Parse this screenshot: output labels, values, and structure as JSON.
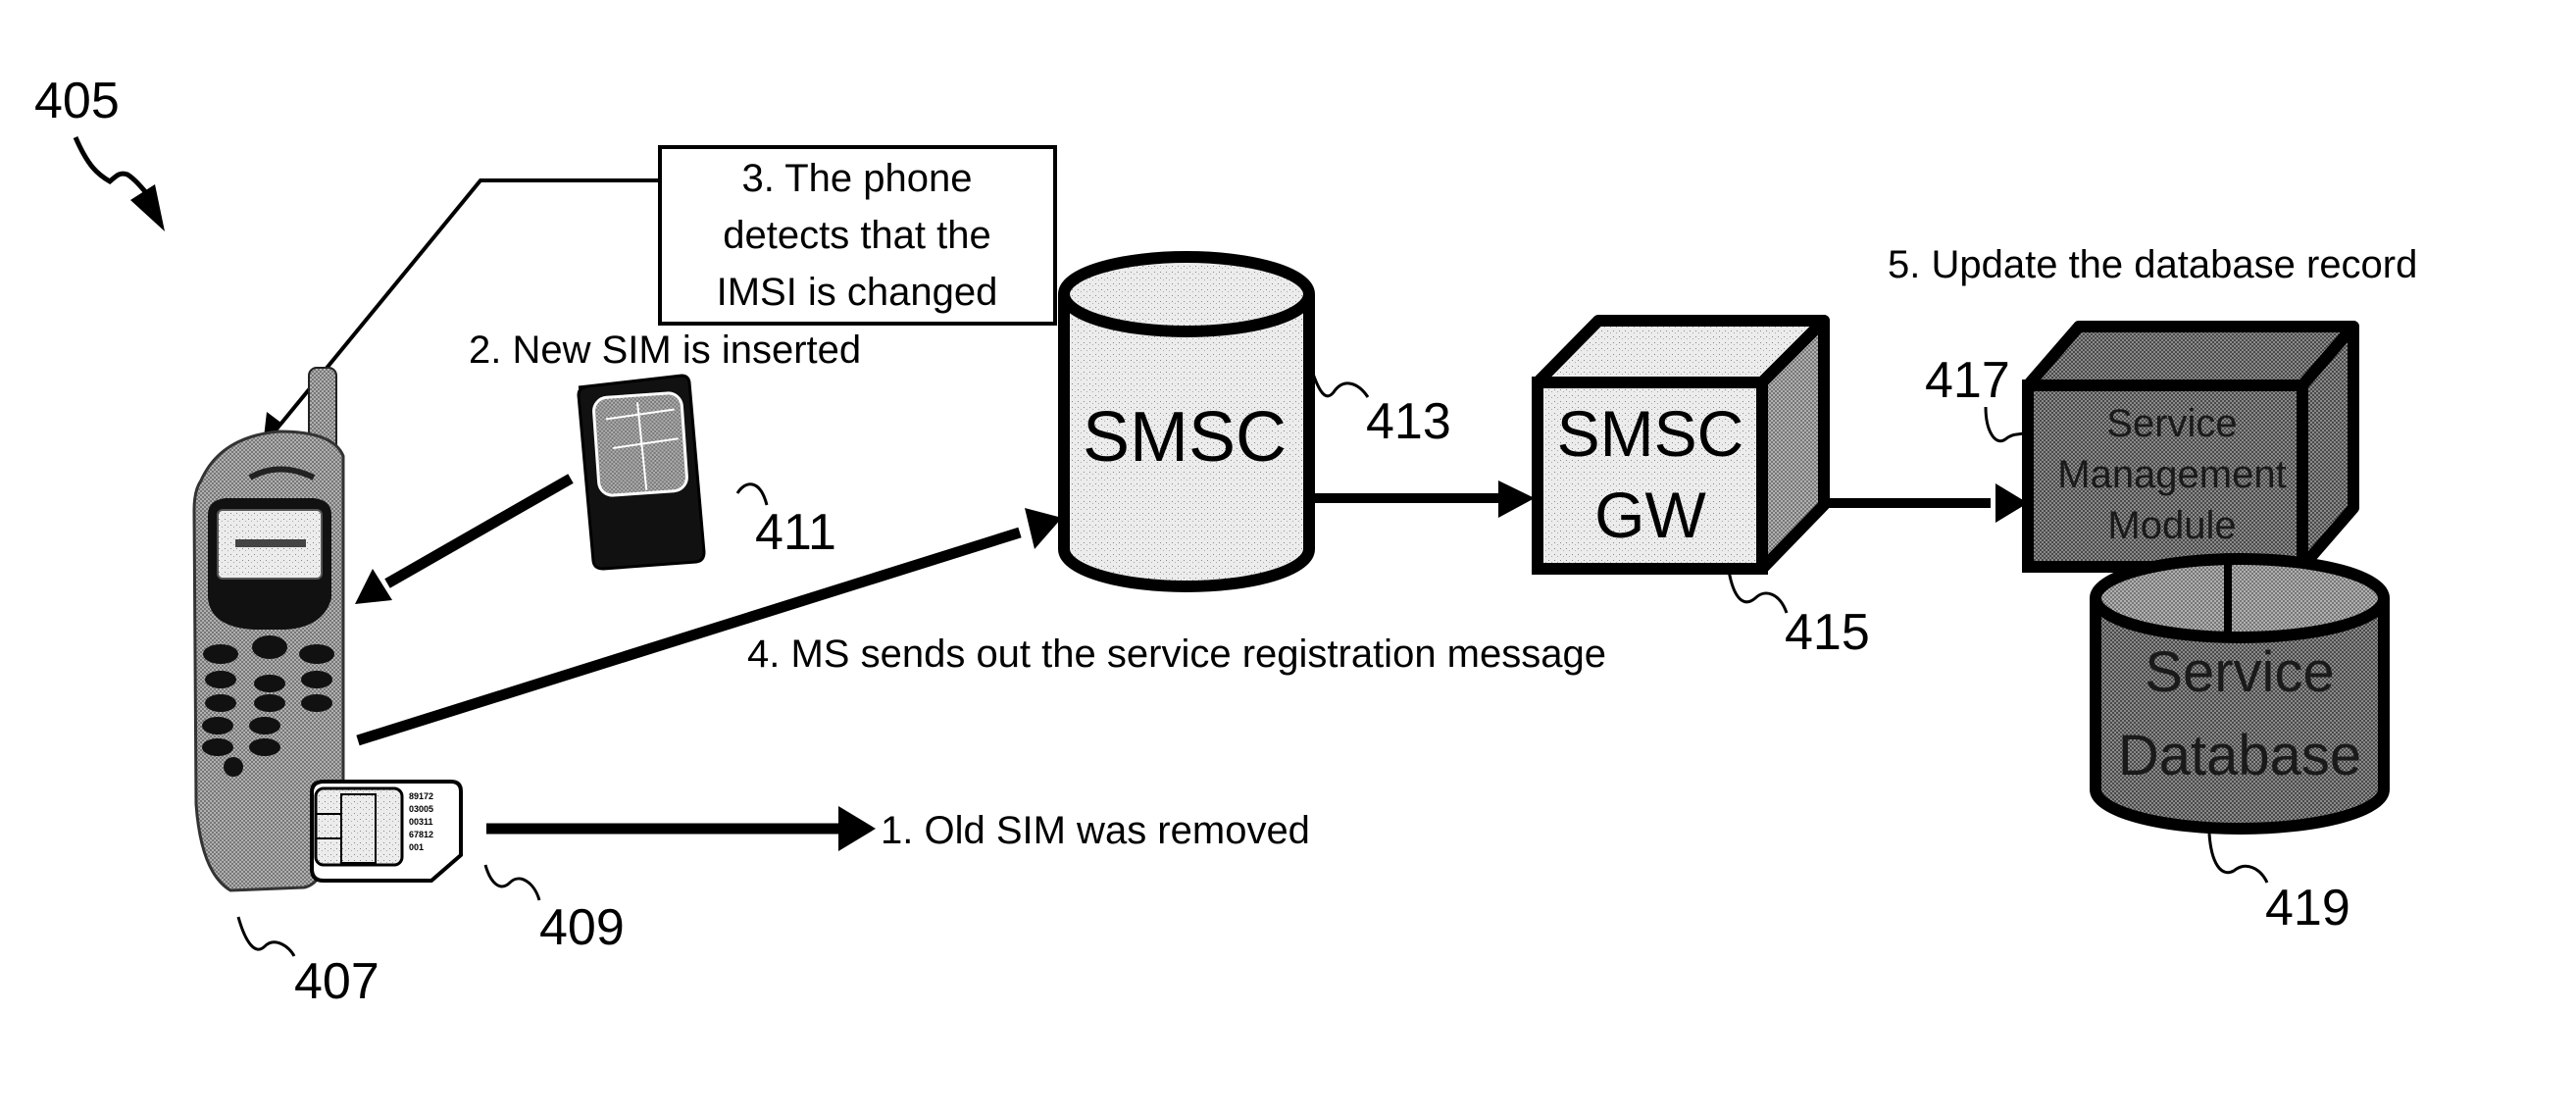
{
  "figure": {
    "reference_number": "405"
  },
  "steps": {
    "step1": "1. Old SIM was removed",
    "step2": "2. New SIM is inserted",
    "step3_lines": [
      "3. The phone",
      "detects that the",
      "IMSI is changed"
    ],
    "step4": "4. MS sends out the service registration message",
    "step5": "5. Update the database record"
  },
  "nodes": {
    "phone": {
      "ref": "407"
    },
    "old_sim": {
      "ref": "409",
      "printed_lines": [
        "89172",
        "03005",
        "00311",
        "67812",
        "001"
      ]
    },
    "new_sim": {
      "ref": "411"
    },
    "smsc": {
      "label": "SMSC",
      "ref": "413"
    },
    "smsc_gw": {
      "label_lines": [
        "SMSC",
        "GW"
      ],
      "ref": "415"
    },
    "service_management_module": {
      "label_lines": [
        "Service",
        "Management",
        "Module"
      ],
      "ref": "417"
    },
    "service_database": {
      "label_lines": [
        "Service",
        "Database"
      ],
      "ref": "419"
    }
  },
  "colors": {
    "ink": "#000000",
    "light_fill": "#e6e6e6",
    "mid_fill": "#9a9a9a",
    "dark_fill": "#6e6e6e",
    "phone_body": "#a8a8a8",
    "phone_screen": "#cfcfcf"
  }
}
